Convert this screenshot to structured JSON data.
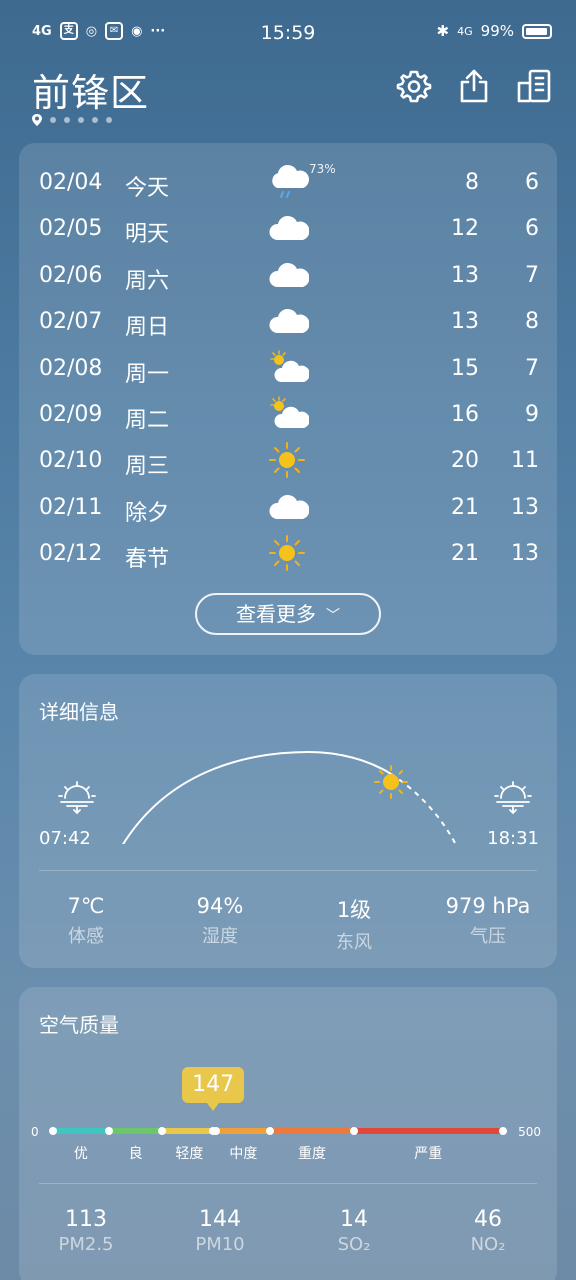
{
  "status_bar": {
    "time": "15:59",
    "network_left": "4G",
    "battery": "99%",
    "network_right": "4G"
  },
  "header": {
    "city": "前锋区"
  },
  "forecast": {
    "rows": [
      {
        "date": "02/04",
        "day": "今天",
        "icon": "rain-cloud-icon",
        "precip": "73%",
        "high": "8",
        "low": "6"
      },
      {
        "date": "02/05",
        "day": "明天",
        "icon": "cloud-icon",
        "precip": "",
        "high": "12",
        "low": "6"
      },
      {
        "date": "02/06",
        "day": "周六",
        "icon": "cloud-icon",
        "precip": "",
        "high": "13",
        "low": "7"
      },
      {
        "date": "02/07",
        "day": "周日",
        "icon": "cloud-icon",
        "precip": "",
        "high": "13",
        "low": "8"
      },
      {
        "date": "02/08",
        "day": "周一",
        "icon": "partly-cloudy-icon",
        "precip": "",
        "high": "15",
        "low": "7"
      },
      {
        "date": "02/09",
        "day": "周二",
        "icon": "partly-cloudy-icon",
        "precip": "",
        "high": "16",
        "low": "9"
      },
      {
        "date": "02/10",
        "day": "周三",
        "icon": "sun-icon",
        "precip": "",
        "high": "20",
        "low": "11"
      },
      {
        "date": "02/11",
        "day": "除夕",
        "icon": "cloud-icon",
        "precip": "",
        "high": "21",
        "low": "13"
      },
      {
        "date": "02/12",
        "day": "春节",
        "icon": "sun-icon",
        "precip": "",
        "high": "21",
        "low": "13"
      }
    ],
    "more_label": "查看更多"
  },
  "details": {
    "title": "详细信息",
    "sunrise": "07:42",
    "sunset": "18:31",
    "stats": [
      {
        "value": "7℃",
        "label": "体感"
      },
      {
        "value": "94%",
        "label": "湿度"
      },
      {
        "value": "1级",
        "label": "东风"
      },
      {
        "value": "979 hPa",
        "label": "气压"
      }
    ]
  },
  "aqi": {
    "title": "空气质量",
    "value": "147",
    "min": "0",
    "max": "500",
    "levels": [
      "优",
      "良",
      "轻度",
      "中度",
      "重度",
      "严重"
    ],
    "level_colors": [
      "#3fc6c0",
      "#6cc66a",
      "#e8c74a",
      "#f0a03a",
      "#ee7a3a",
      "#e0493a"
    ],
    "pollutants": [
      {
        "value": "113",
        "label": "PM2.5"
      },
      {
        "value": "144",
        "label": "PM10"
      },
      {
        "value": "14",
        "label": "SO₂"
      },
      {
        "value": "46",
        "label": "NO₂"
      }
    ]
  }
}
